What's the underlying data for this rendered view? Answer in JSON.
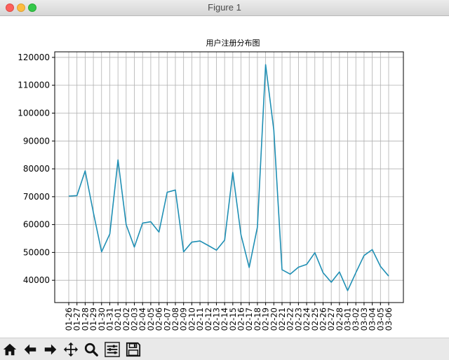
{
  "window": {
    "title": "Figure 1"
  },
  "toolbar": {
    "buttons": [
      {
        "icon": "home-icon"
      },
      {
        "icon": "back-arrow-icon"
      },
      {
        "icon": "forward-arrow-icon"
      },
      {
        "icon": "pan-icon"
      },
      {
        "icon": "zoom-icon"
      },
      {
        "icon": "configure-subplots-icon"
      },
      {
        "icon": "save-icon"
      }
    ]
  },
  "chart_data": {
    "type": "line",
    "title": "用户注册分布图",
    "xlabel": "",
    "ylabel": "",
    "grid": true,
    "line_color": "#1f8fb4",
    "ylim": [
      32000,
      122000
    ],
    "yticks": [
      40000,
      50000,
      60000,
      70000,
      80000,
      90000,
      100000,
      110000,
      120000
    ],
    "categories": [
      "01-26",
      "01-27",
      "01-28",
      "01-29",
      "01-30",
      "01-31",
      "02-01",
      "02-02",
      "02-03",
      "02-04",
      "02-05",
      "02-06",
      "02-07",
      "02-08",
      "02-09",
      "02-10",
      "02-11",
      "02-12",
      "02-13",
      "02-14",
      "02-15",
      "02-16",
      "02-17",
      "02-18",
      "02-19",
      "02-20",
      "02-21",
      "02-22",
      "02-23",
      "02-24",
      "02-25",
      "02-26",
      "02-27",
      "02-28",
      "03-01",
      "03-02",
      "03-03",
      "03-04",
      "03-05",
      "03-06"
    ],
    "values": [
      70200,
      70400,
      79300,
      64300,
      50200,
      56600,
      83200,
      60000,
      51900,
      60500,
      61000,
      57300,
      71600,
      72400,
      50200,
      53700,
      54100,
      52500,
      50800,
      54400,
      78700,
      56300,
      44600,
      59100,
      117400,
      93900,
      43800,
      42200,
      44700,
      45700,
      49900,
      42700,
      39300,
      43000,
      36300,
      42700,
      48900,
      51000,
      45000,
      41500
    ]
  }
}
